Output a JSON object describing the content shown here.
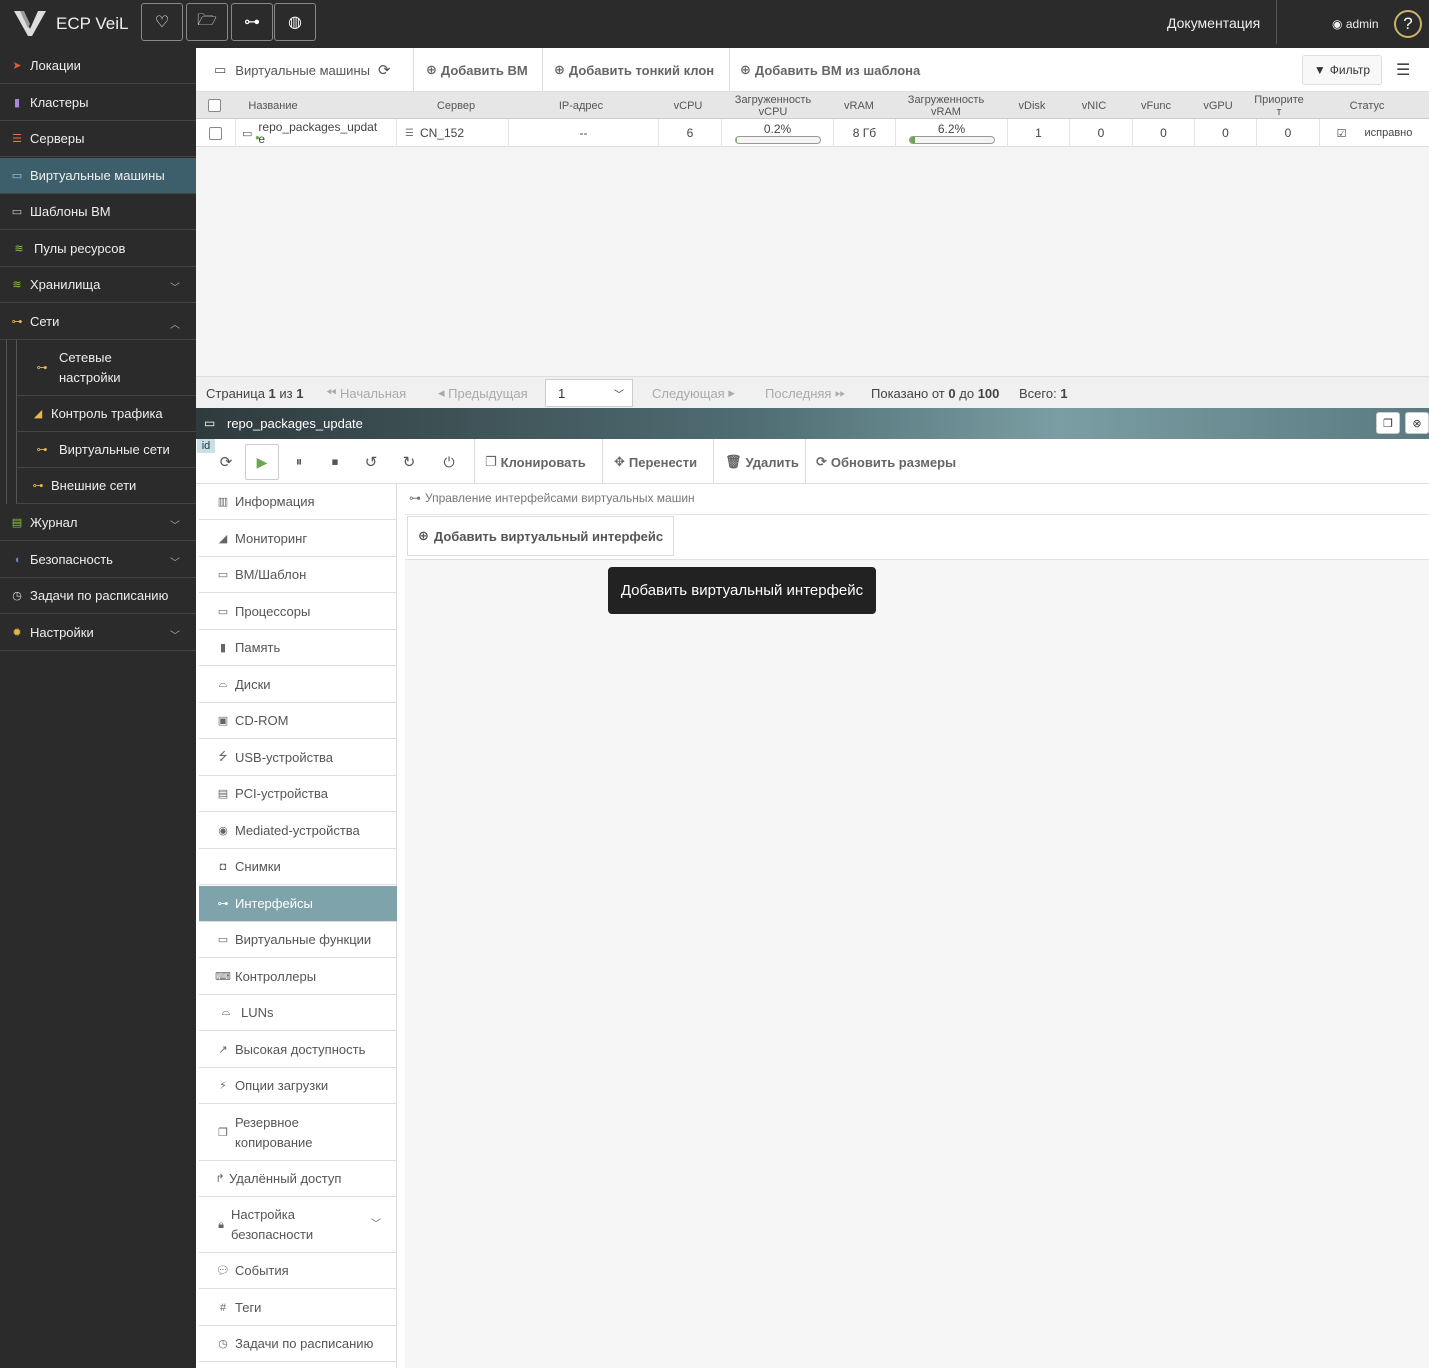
{
  "app": {
    "brand": "ECP VeiL",
    "docs_label": "Документация",
    "user": "admin",
    "help": "?"
  },
  "sidebar": {
    "items": [
      {
        "label": "Локации",
        "icon": "location-arrow-icon",
        "icon_color": "#e05a3a"
      },
      {
        "label": "Кластеры",
        "icon": "cluster-icon",
        "icon_color": "#a58ad8"
      },
      {
        "label": "Серверы",
        "icon": "server-icon",
        "icon_color": "#e07a4a"
      },
      {
        "label": "Виртуальные машины",
        "icon": "monitor-icon",
        "icon_color": "#8ecae6"
      },
      {
        "label": "Шаблоны ВМ",
        "icon": "monitor-template-icon",
        "icon_color": "#ccc"
      },
      {
        "label": "Пулы ресурсов",
        "icon": "resource-pool-icon",
        "icon_color": "#8bc34a"
      },
      {
        "label": "Хранилища",
        "icon": "database-icon",
        "icon_color": "#8bc34a"
      },
      {
        "label": "Сети",
        "icon": "network-icon",
        "icon_color": "#e6b84a"
      },
      {
        "label": "Сетевые настройки",
        "icon": "network-settings-icon",
        "icon_color": "#e6b84a"
      },
      {
        "label": "Контроль трафика",
        "icon": "area-chart-icon",
        "icon_color": "#e6b84a"
      },
      {
        "label": "Виртуальные сети",
        "icon": "virtual-network-icon",
        "icon_color": "#e6b84a"
      },
      {
        "label": "Внешние сети",
        "icon": "external-network-icon",
        "icon_color": "#e6b84a"
      },
      {
        "label": "Журнал",
        "icon": "journal-icon",
        "icon_color": "#8bc34a"
      },
      {
        "label": "Безопасность",
        "icon": "shield-icon",
        "icon_color": "#5b8ad8"
      },
      {
        "label": "Задачи по расписанию",
        "icon": "clock-icon",
        "icon_color": "#ddd"
      },
      {
        "label": "Настройки",
        "icon": "gear-icon",
        "icon_color": "#e6b84a"
      }
    ]
  },
  "vmlist": {
    "title": "Виртуальные машины",
    "add_vm": "Добавить ВМ",
    "add_thin_clone": "Добавить тонкий клон",
    "add_from_template": "Добавить ВМ из шаблона",
    "filter": "Фильтр",
    "columns": {
      "name": "Название",
      "server": "Сервер",
      "ip": "IP-адрес",
      "vcpu": "vCPU",
      "vcpu_load": "Загруженность vCPU",
      "vram": "vRAM",
      "vram_load": "Загруженность vRAM",
      "vdisk": "vDisk",
      "vnic": "vNIC",
      "vfunc": "vFunc",
      "vgpu": "vGPU",
      "priority": "Приоритет",
      "status": "Статус"
    },
    "row": {
      "name": "repo_packages_update",
      "server": "CN_152",
      "ip": "--",
      "vcpu": "6",
      "vcpu_load": "0.2%",
      "vcpu_load_fraction": 0.002,
      "vram": "8 Гб",
      "vram_load": "6.2%",
      "vram_load_fraction": 0.062,
      "vdisk": "1",
      "vnic": "0",
      "vfunc": "0",
      "vgpu": "0",
      "priority": "0",
      "status": "исправно"
    }
  },
  "pager": {
    "page_label": "Страница",
    "page": "1",
    "of_label": "из",
    "pages": "1",
    "first": "Начальная",
    "prev": "Предыдущая",
    "selected": "1",
    "next": "Следующая",
    "last": "Последняя",
    "shown_label": "Показано от",
    "from": "0",
    "to_label": "до",
    "to": "100",
    "total_label": "Всего:",
    "total": "1"
  },
  "detail": {
    "title": "repo_packages_update",
    "id_tag": "id",
    "clone": "Клонировать",
    "migrate": "Перенести",
    "delete": "Удалить",
    "refresh_sizes": "Обновить размеры",
    "menu": [
      {
        "label": "Информация",
        "icon": "bar-chart-icon"
      },
      {
        "label": "Мониторинг",
        "icon": "area-chart-icon"
      },
      {
        "label": "ВМ/Шаблон",
        "icon": "monitor-icon"
      },
      {
        "label": "Процессоры",
        "icon": "laptop-icon"
      },
      {
        "label": "Память",
        "icon": "memory-icon"
      },
      {
        "label": "Диски",
        "icon": "hdd-icon"
      },
      {
        "label": "CD-ROM",
        "icon": "floppy-icon"
      },
      {
        "label": "USB-устройства",
        "icon": "usb-icon"
      },
      {
        "label": "PCI-устройства",
        "icon": "pci-icon"
      },
      {
        "label": "Mediated-устройства",
        "icon": "podcast-icon"
      },
      {
        "label": "Снимки",
        "icon": "camera-icon"
      },
      {
        "label": "Интерфейсы",
        "icon": "network-icon"
      },
      {
        "label": "Виртуальные функции",
        "icon": "monitor-icon"
      },
      {
        "label": "Контроллеры",
        "icon": "keyboard-icon"
      },
      {
        "label": "LUNs",
        "icon": "lun-icon"
      },
      {
        "label": "Высокая доступность",
        "icon": "line-chart-icon"
      },
      {
        "label": "Опции загрузки",
        "icon": "plug-icon"
      },
      {
        "label": "Резервное копирование",
        "icon": "copy-icon"
      },
      {
        "label": "Удалённый доступ",
        "icon": "level-up-icon"
      },
      {
        "label": "Настройка безопасности",
        "icon": "lock-icon"
      },
      {
        "label": "События",
        "icon": "comment-icon"
      },
      {
        "label": "Теги",
        "icon": "hashtag-icon"
      },
      {
        "label": "Задачи по расписанию",
        "icon": "clock-icon"
      }
    ],
    "crumb": "Управление интерфейсами виртуальных машин",
    "add_interface": "Добавить виртуальный интерфейс",
    "tooltip": "Добавить виртуальный интерфейс"
  }
}
